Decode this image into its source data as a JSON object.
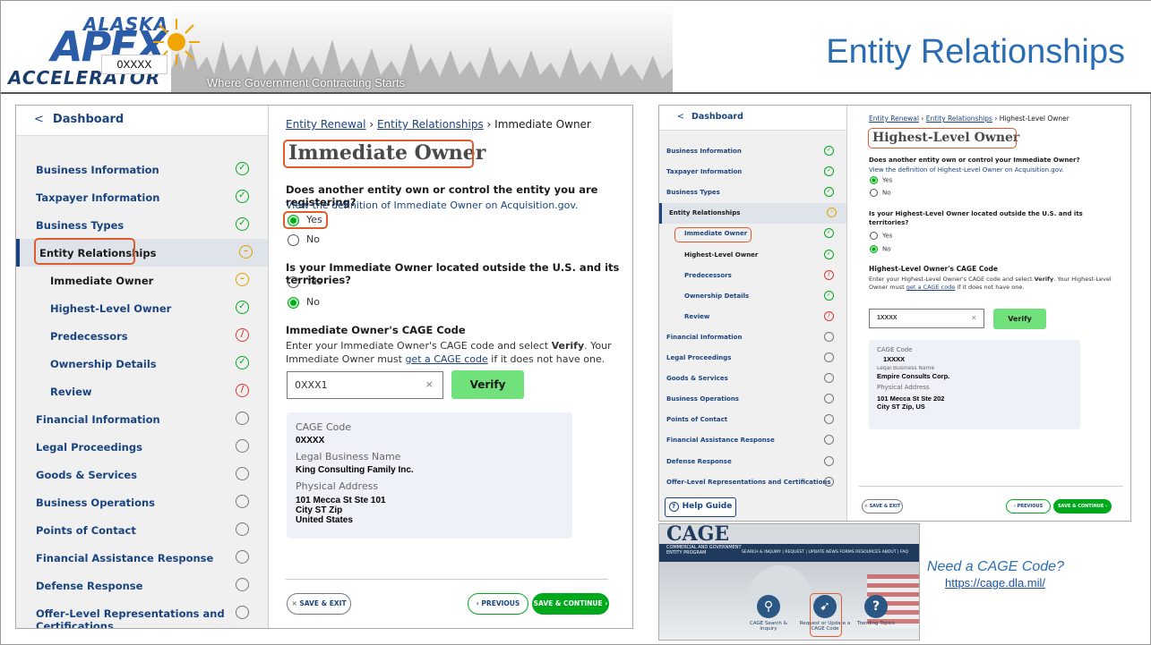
{
  "header": {
    "logo_top": "ALASKA",
    "logo_main": "APEX",
    "logo_bottom": "ACCELERATOR",
    "logo_overlay": "0XXXX",
    "tagline": "Where Government Contracting Starts",
    "title": "Entity Relationships"
  },
  "left_shot": {
    "back": "Dashboard",
    "nav": [
      {
        "label": "Business Information",
        "status": "complete"
      },
      {
        "label": "Taxpayer Information",
        "status": "complete"
      },
      {
        "label": "Business Types",
        "status": "complete"
      },
      {
        "label": "Entity Relationships",
        "status": "in-progress"
      },
      {
        "label": "Immediate Owner",
        "status": "in-progress",
        "sub": true
      },
      {
        "label": "Highest-Level Owner",
        "status": "complete",
        "sub": true
      },
      {
        "label": "Predecessors",
        "status": "error",
        "sub": true
      },
      {
        "label": "Ownership Details",
        "status": "complete",
        "sub": true
      },
      {
        "label": "Review",
        "status": "error",
        "sub": true
      },
      {
        "label": "Financial Information",
        "status": "empty"
      },
      {
        "label": "Legal Proceedings",
        "status": "empty"
      },
      {
        "label": "Goods & Services",
        "status": "empty"
      },
      {
        "label": "Business Operations",
        "status": "empty"
      },
      {
        "label": "Points of Contact",
        "status": "empty"
      },
      {
        "label": "Financial Assistance Response",
        "status": "empty"
      },
      {
        "label": "Defense Response",
        "status": "empty"
      },
      {
        "label": "Offer-Level Representations and Certifications",
        "status": "empty"
      }
    ],
    "breadcrumb": {
      "c1": "Entity Renewal",
      "c2": "Entity Relationships",
      "c3": "Immediate Owner"
    },
    "heading": "Immediate Owner",
    "q1": "Does another entity own or control the entity you are registering?",
    "q1_link": "View the definition of Immediate Owner on Acquisition.gov.",
    "yes": "Yes",
    "no": "No",
    "q2": "Is your Immediate Owner located outside the U.S. and its territories?",
    "cage_heading": "Immediate Owner's CAGE Code",
    "cage_help_1": "Enter your Immediate Owner's CAGE code and select",
    "cage_help_verify": "Verify",
    "cage_help_2": ". Your Immediate Owner",
    "cage_help_3": "must",
    "cage_help_link": "get a CAGE code",
    "cage_help_4": "if it does not have one.",
    "cage_input_value": "0XXX1",
    "clear": "×",
    "verify": "Verify",
    "card": {
      "cage_label": "CAGE Code",
      "cage_value": "0XXXX",
      "name_label": "Legal Business Name",
      "name_value": "King Consulting Family Inc.",
      "addr_label": "Physical Address",
      "addr_1": "101 Mecca St Ste 101",
      "addr_2": "City ST Zip",
      "addr_3": "United States"
    },
    "save_exit": "SAVE & EXIT",
    "previous": "PREVIOUS",
    "save_continue": "SAVE & CONTINUE"
  },
  "right_shot": {
    "back": "Dashboard",
    "nav": [
      {
        "label": "Business Information",
        "status": "complete"
      },
      {
        "label": "Taxpayer Information",
        "status": "complete"
      },
      {
        "label": "Business Types",
        "status": "complete"
      },
      {
        "label": "Entity Relationships",
        "status": "in-progress"
      },
      {
        "label": "Immediate Owner",
        "status": "complete",
        "sub": true
      },
      {
        "label": "Highest-Level Owner",
        "status": "complete",
        "sub": true
      },
      {
        "label": "Predecessors",
        "status": "error",
        "sub": true
      },
      {
        "label": "Ownership Details",
        "status": "complete",
        "sub": true
      },
      {
        "label": "Review",
        "status": "error",
        "sub": true
      },
      {
        "label": "Financial Information",
        "status": "empty"
      },
      {
        "label": "Legal Proceedings",
        "status": "empty"
      },
      {
        "label": "Goods & Services",
        "status": "empty"
      },
      {
        "label": "Business Operations",
        "status": "empty"
      },
      {
        "label": "Points of Contact",
        "status": "empty"
      },
      {
        "label": "Financial Assistance Response",
        "status": "empty"
      },
      {
        "label": "Defense Response",
        "status": "empty"
      },
      {
        "label": "Offer-Level Representations and Certifications",
        "status": "empty"
      }
    ],
    "help_guide": "Help Guide",
    "breadcrumb": {
      "c1": "Entity Renewal",
      "c2": "Entity Relationships",
      "c3": "Highest-Level Owner"
    },
    "heading": "Highest-Level Owner",
    "q1": "Does another entity own or control your Immediate Owner?",
    "q1_link": "View the definition of Highest-Level Owner on Acquisition.gov.",
    "yes": "Yes",
    "no": "No",
    "q2": "Is your Highest-Level Owner located outside the U.S. and its territories?",
    "cage_heading": "Highest-Level Owner's CAGE Code",
    "cage_help_1": "Enter your Highest-Level Owner's CAGE code and select",
    "cage_help_verify": "Verify",
    "cage_help_2": ". Your Highest-Level",
    "cage_help_3": "Owner must",
    "cage_help_link": "get a CAGE code",
    "cage_help_4": "if it does not have one.",
    "cage_input_value": "1XXXX",
    "clear": "×",
    "verify": "Verify",
    "card": {
      "cage_label": "CAGE Code",
      "cage_value": "1XXXX",
      "name_label": "Legal Business Name",
      "name_value": "Empire Consults Corp.",
      "addr_label": "Physical Address",
      "addr_1": "101 Mecca St Ste 202",
      "addr_2": "City ST Zip, US"
    },
    "save_exit": "SAVE & EXIT",
    "previous": "PREVIOUS",
    "save_continue": "SAVE & CONTINUE"
  },
  "cage_site": {
    "logo": "CAGE",
    "subtitle_1": "COMMERCIAL AND GOVERNMENT",
    "subtitle_2": "ENTITY PROGRAM",
    "menu": "SEARCH & INQUIRY | REQUEST | UPDATE  NEWS  FORMS  RESOURCES  ABOUT | FAQ",
    "tiles": [
      {
        "label": "CAGE Search & Inquiry",
        "icon": "search-icon"
      },
      {
        "label": "Request or Update a CAGE Code",
        "icon": "pointer-icon"
      },
      {
        "label": "Trending Topics",
        "icon": "question-icon"
      }
    ]
  },
  "callout": {
    "need": "Need a CAGE Code?",
    "url": "https://cage.dla.mil/"
  },
  "colors": {
    "title_blue": "#2a6db2",
    "link_navy": "#1a4480",
    "success_green": "#00a91c",
    "highlight_orange": "#e25b2b",
    "warning_yellow": "#e5a000",
    "error_red": "#d83933"
  }
}
